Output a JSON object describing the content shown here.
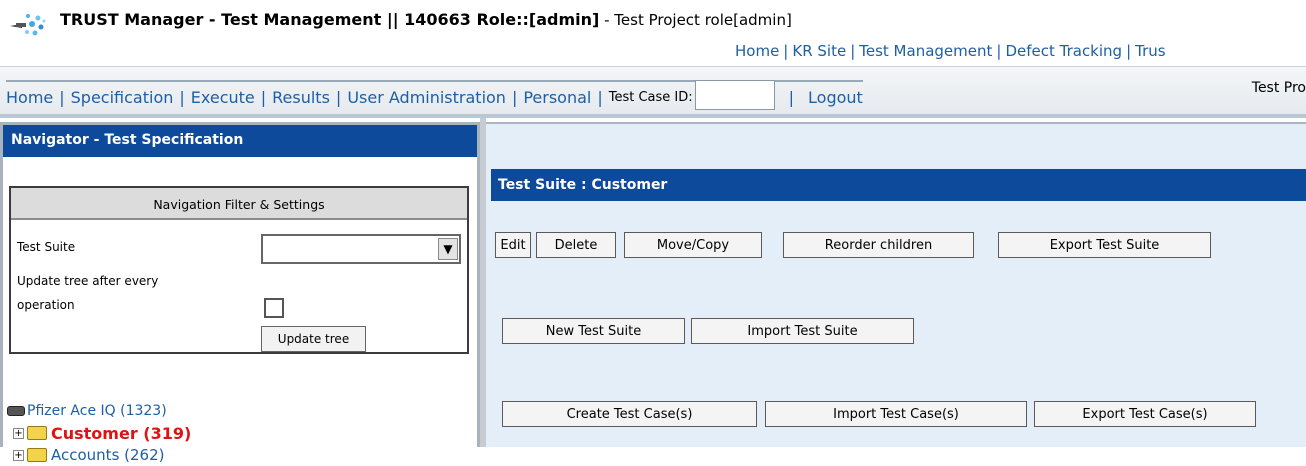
{
  "header": {
    "title_main": "TRUST Manager - Test Management || 140663 Role::[admin]",
    "title_role": " - Test Project role[admin]",
    "site_links": [
      "Home",
      "KR Site",
      "Test Management",
      "Defect Tracking",
      "Trus"
    ]
  },
  "menubar": {
    "links": [
      "Home",
      "Specification",
      "Execute",
      "Results",
      "User Administration",
      "Personal"
    ],
    "test_case_id_label": "Test Case ID:",
    "test_case_id_value": "",
    "logout_label": "Logout",
    "project_label": "Test Pro"
  },
  "navigator": {
    "title": "Navigator - Test Specification",
    "filter": {
      "title": "Navigation Filter & Settings",
      "test_suite_label": "Test Suite",
      "test_suite_value": "",
      "update_tree_label_line1": "Update tree after every",
      "update_tree_label_line2": "operation",
      "update_tree_checked": false,
      "update_button": "Update tree"
    },
    "tree": {
      "root": "Pfizer Ace IQ (1323)",
      "items": [
        {
          "label": "Customer (319)",
          "selected": true
        },
        {
          "label": "Accounts (262)",
          "selected": false
        }
      ]
    }
  },
  "main": {
    "suite_title": "Test Suite : Customer",
    "row1_buttons": [
      "Edit",
      "Delete",
      "Move/Copy",
      "Reorder children",
      "Export Test Suite"
    ],
    "row2_buttons": [
      "New Test Suite",
      "Import Test Suite"
    ],
    "row3_buttons": [
      "Create Test Case(s)",
      "Import Test Case(s)",
      "Export Test Case(s)"
    ]
  },
  "colors": {
    "header_bar": "#0d4a9b",
    "link": "#1d5fa6",
    "selected_tree_item": "#e01212",
    "content_background": "#e3eef9"
  }
}
